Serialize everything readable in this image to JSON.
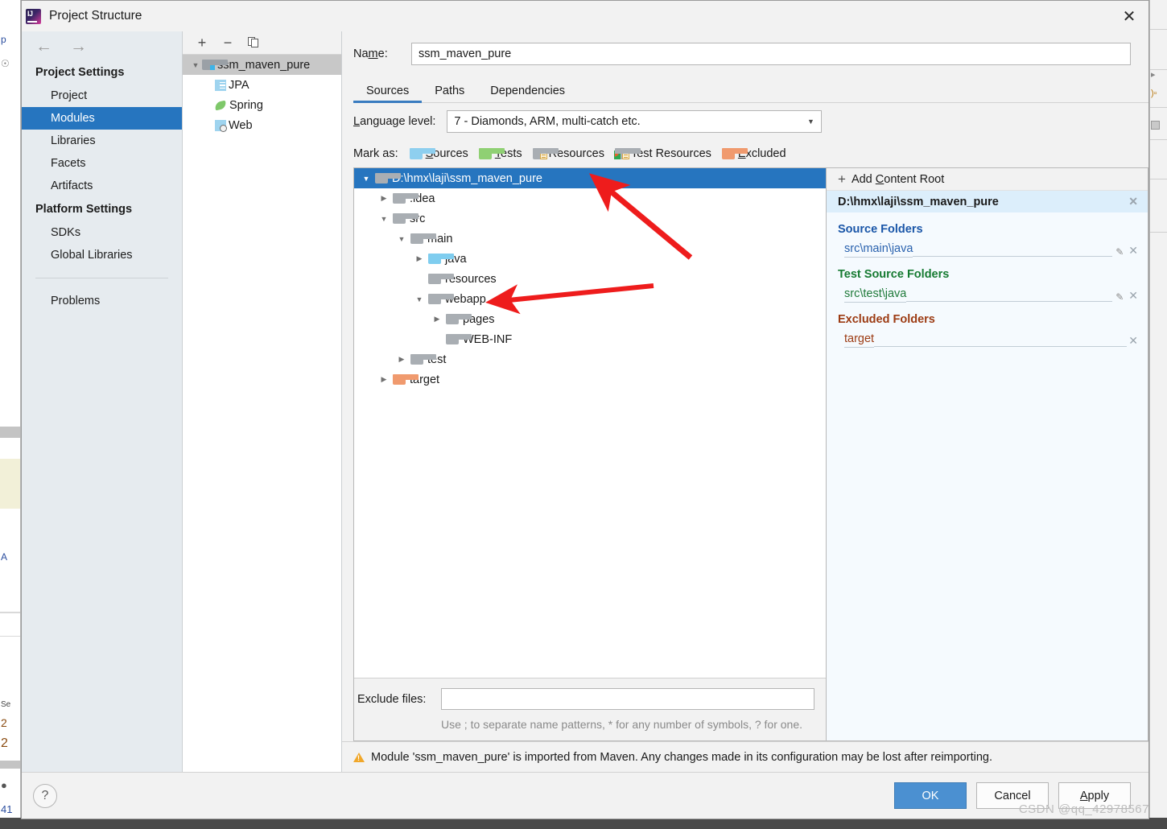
{
  "window": {
    "title": "Project Structure",
    "app_icon": "intellij-idea-icon",
    "close_icon": "close-icon"
  },
  "nav": {
    "back_icon": "arrow-left-icon",
    "forward_icon": "arrow-right-icon",
    "groups": [
      {
        "title": "Project Settings",
        "items": [
          {
            "label": "Project",
            "selected": false
          },
          {
            "label": "Modules",
            "selected": true
          },
          {
            "label": "Libraries",
            "selected": false
          },
          {
            "label": "Facets",
            "selected": false
          },
          {
            "label": "Artifacts",
            "selected": false
          }
        ]
      },
      {
        "title": "Platform Settings",
        "items": [
          {
            "label": "SDKs",
            "selected": false
          },
          {
            "label": "Global Libraries",
            "selected": false
          }
        ]
      }
    ],
    "problems_label": "Problems"
  },
  "modules_panel": {
    "toolbar": {
      "add_label": "+",
      "remove_label": "−",
      "copy_icon": "copy-icon"
    },
    "tree": [
      {
        "label": "ssm_maven_pure",
        "icon": "module-folder-icon",
        "twisty": "▼",
        "selected": true,
        "depth": 0
      },
      {
        "label": "JPA",
        "icon": "jpa-facet-icon",
        "twisty": "",
        "selected": false,
        "depth": 1
      },
      {
        "label": "Spring",
        "icon": "spring-facet-icon",
        "twisty": "",
        "selected": false,
        "depth": 1
      },
      {
        "label": "Web",
        "icon": "web-facet-icon",
        "twisty": "",
        "selected": false,
        "depth": 1
      }
    ]
  },
  "module": {
    "name_label": "Name:",
    "name_value": "ssm_maven_pure",
    "tabs": [
      {
        "label": "Sources",
        "active": true
      },
      {
        "label": "Paths",
        "active": false
      },
      {
        "label": "Dependencies",
        "active": false
      }
    ],
    "language_level_label": "Language level:",
    "language_level_value": "7 - Diamonds, ARM, multi-catch etc.",
    "language_level_options": [
      "7 - Diamonds, ARM, multi-catch etc."
    ],
    "mark_as_label": "Mark as:",
    "mark_as": [
      {
        "label": "Sources",
        "mnemonic": "S",
        "icon": "folder-sources-icon",
        "color": "#8ecfef"
      },
      {
        "label": "Tests",
        "mnemonic": "T",
        "icon": "folder-tests-icon",
        "color": "#8fd073"
      },
      {
        "label": "Resources",
        "mnemonic": "R",
        "icon": "folder-resources-icon",
        "color": "#a9aeb3"
      },
      {
        "label": "Test Resources",
        "mnemonic": "",
        "icon": "folder-test-resources-icon",
        "color": "#a9aeb3"
      },
      {
        "label": "Excluded",
        "mnemonic": "E",
        "icon": "folder-excluded-icon",
        "color": "#f09a6e"
      }
    ]
  },
  "content_tree": [
    {
      "label": "D:\\hmx\\laji\\ssm_maven_pure",
      "depth": 0,
      "twisty": "▼",
      "folder": "gray",
      "selected": true
    },
    {
      "label": ".idea",
      "depth": 1,
      "twisty": "▶",
      "folder": "gray",
      "selected": false
    },
    {
      "label": "src",
      "depth": 1,
      "twisty": "▼",
      "folder": "gray",
      "selected": false
    },
    {
      "label": "main",
      "depth": 2,
      "twisty": "▼",
      "folder": "gray",
      "selected": false
    },
    {
      "label": "java",
      "depth": 3,
      "twisty": "▶",
      "folder": "blue",
      "selected": false
    },
    {
      "label": "resources",
      "depth": 3,
      "twisty": "",
      "folder": "gray",
      "selected": false
    },
    {
      "label": "webapp",
      "depth": 3,
      "twisty": "▼",
      "folder": "gray",
      "selected": false
    },
    {
      "label": "pages",
      "depth": 4,
      "twisty": "▶",
      "folder": "gray",
      "selected": false
    },
    {
      "label": "WEB-INF",
      "depth": 4,
      "twisty": "",
      "folder": "gray",
      "selected": false
    },
    {
      "label": "test",
      "depth": 2,
      "twisty": "▶",
      "folder": "gray",
      "selected": false
    },
    {
      "label": "target",
      "depth": 1,
      "twisty": "▶",
      "folder": "orange",
      "selected": false
    }
  ],
  "exclude": {
    "label": "Exclude files:",
    "value": "",
    "placeholder": "",
    "hint": "Use ; to separate name patterns, * for any number of symbols, ? for one."
  },
  "detail": {
    "add_content_root_label": "Add Content Root",
    "add_content_root_mnemonic": "C",
    "add_icon": "plus-icon",
    "content_root": "D:\\hmx\\laji\\ssm_maven_pure",
    "content_root_remove_icon": "close-icon",
    "sections": [
      {
        "title": "Source Folders",
        "kind": "src",
        "color": "#1a56a8",
        "folders": [
          {
            "path": "src\\main\\java",
            "has_edit": true,
            "edit_icon": "pencil-icon",
            "remove_icon": "close-icon"
          }
        ]
      },
      {
        "title": "Test Source Folders",
        "kind": "test",
        "color": "#157a31",
        "folders": [
          {
            "path": "src\\test\\java",
            "has_edit": true,
            "edit_icon": "pencil-icon",
            "remove_icon": "close-icon"
          }
        ]
      },
      {
        "title": "Excluded Folders",
        "kind": "exc",
        "color": "#9c3b13",
        "folders": [
          {
            "path": "target",
            "has_edit": false,
            "edit_icon": "",
            "remove_icon": "close-icon"
          }
        ]
      }
    ]
  },
  "warning": {
    "icon": "warning-triangle-icon",
    "text": "Module 'ssm_maven_pure' is imported from Maven. Any changes made in its configuration may be lost after reimporting."
  },
  "footer": {
    "help_label": "?",
    "buttons": [
      {
        "label": "OK",
        "mnemonic": "",
        "primary": true
      },
      {
        "label": "Cancel",
        "mnemonic": "",
        "primary": false
      },
      {
        "label": "Apply",
        "mnemonic": "A",
        "primary": false
      }
    ]
  },
  "annotations": {
    "arrow_color": "#ee1c1c",
    "arrow1_target": "Resources",
    "arrow2_target": "resources"
  },
  "watermark": "CSDN @qq_42978567"
}
